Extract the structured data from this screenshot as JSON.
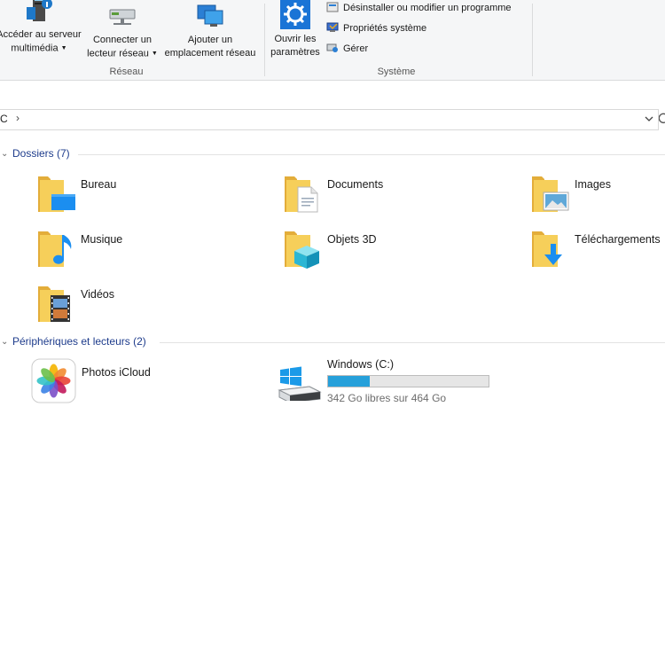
{
  "ribbon": {
    "reseau": {
      "label": "Réseau",
      "buttons": [
        {
          "line1": "Accéder au serveur",
          "line2": "multimédia",
          "icon": "media-server-icon"
        },
        {
          "line1": "Connecter un",
          "line2": "lecteur réseau",
          "icon": "network-drive-icon"
        },
        {
          "line1": "Ajouter un",
          "line2": "emplacement réseau",
          "icon": "network-location-icon"
        }
      ]
    },
    "systeme": {
      "label": "Système",
      "settings_button": {
        "line1": "Ouvrir les",
        "line2": "paramètres",
        "icon": "settings-gear-icon"
      },
      "small_buttons": [
        {
          "label": "Désinstaller ou modifier un programme",
          "icon": "uninstall-icon"
        },
        {
          "label": "Propriétés système",
          "icon": "system-properties-icon"
        },
        {
          "label": "Gérer",
          "icon": "manage-icon"
        }
      ]
    }
  },
  "address": {
    "crumb": "C",
    "separator": "›",
    "dropdown_icon": "chevron-down-icon",
    "refresh_icon": "refresh-icon"
  },
  "folders": {
    "title": "Dossiers (7)",
    "items": [
      {
        "label": "Bureau",
        "icon": "desktop-folder-icon"
      },
      {
        "label": "Documents",
        "icon": "documents-folder-icon"
      },
      {
        "label": "Images",
        "icon": "pictures-folder-icon"
      },
      {
        "label": "Musique",
        "icon": "music-folder-icon"
      },
      {
        "label": "Objets 3D",
        "icon": "3d-objects-folder-icon"
      },
      {
        "label": "Téléchargements",
        "icon": "downloads-folder-icon"
      },
      {
        "label": "Vidéos",
        "icon": "videos-folder-icon"
      }
    ]
  },
  "devices": {
    "title": "Périphériques et lecteurs (2)",
    "items": [
      {
        "label": "Photos iCloud",
        "icon": "icloud-photos-icon"
      },
      {
        "label": "Windows (C:)",
        "icon": "windows-drive-icon",
        "free_text": "342 Go libres sur 464 Go",
        "used_fraction": 0.26
      }
    ]
  },
  "colors": {
    "accent": "#26a0da",
    "section_title": "#1e3c8c",
    "folder": "#f0c24b"
  }
}
